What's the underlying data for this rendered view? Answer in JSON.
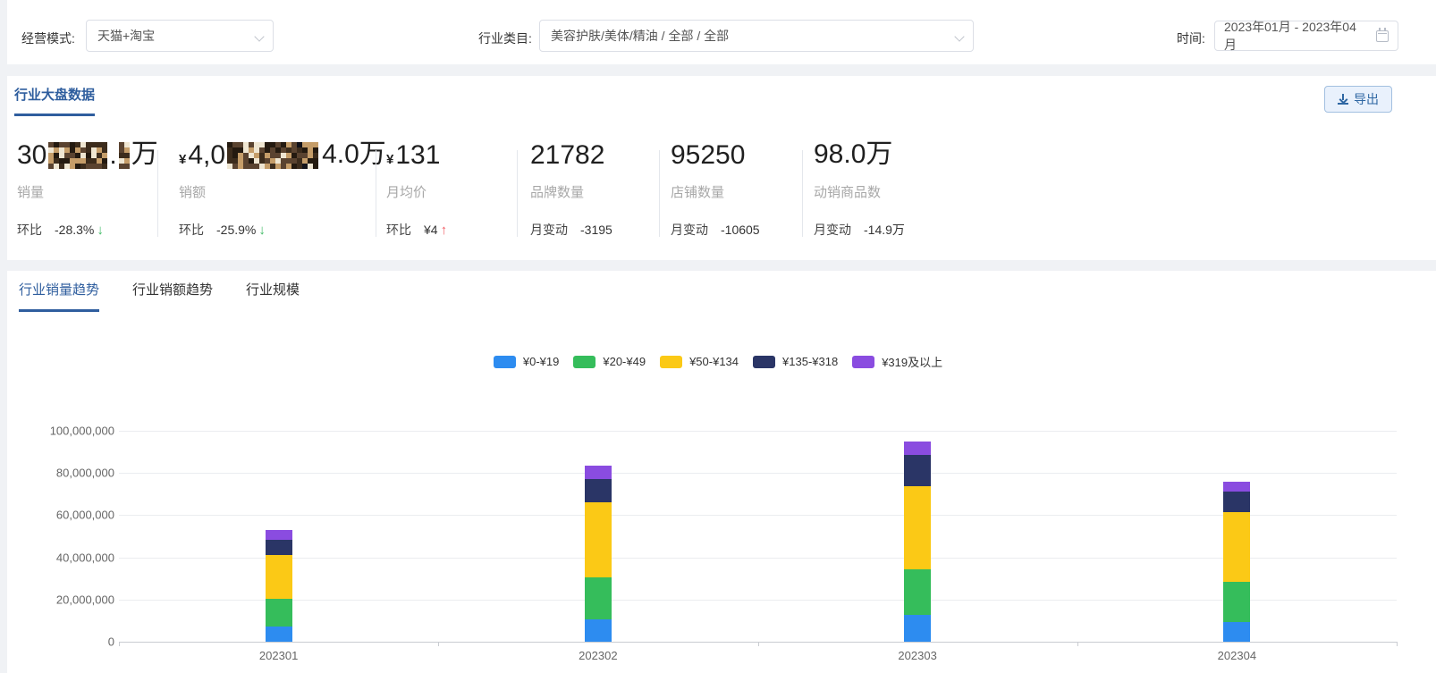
{
  "filters": {
    "mode_label": "经营模式:",
    "mode_value": "天猫+淘宝",
    "category_label": "行业类目:",
    "category_value": "美容护肤/美体/精油 / 全部 / 全部",
    "time_label": "时间:",
    "time_value": "2023年01月 - 2023年04月"
  },
  "overview": {
    "tab_label": "行业大盘数据",
    "export_label": "导出",
    "stats": [
      {
        "label": "销量",
        "censored": true,
        "parts": [
          {
            "t": "text",
            "v": "30"
          },
          {
            "t": "mosaic",
            "w": 66
          },
          {
            "t": "text",
            "v": "."
          },
          {
            "t": "mosaic",
            "w": 12
          },
          {
            "t": "text",
            "v": "万"
          }
        ],
        "change_label": "环比",
        "change_value": "-28.3%",
        "trend": "down"
      },
      {
        "label": "销额",
        "censored": true,
        "parts": [
          {
            "t": "yen",
            "v": "¥"
          },
          {
            "t": "text",
            "v": "4,0"
          },
          {
            "t": "mosaic",
            "w": 104
          },
          {
            "t": "text",
            "v": "4.0万"
          }
        ],
        "change_label": "环比",
        "change_value": "-25.9%",
        "trend": "down"
      },
      {
        "label": "月均价",
        "censored": false,
        "parts": [
          {
            "t": "yen",
            "v": "¥"
          },
          {
            "t": "text",
            "v": "131"
          }
        ],
        "change_label": "环比",
        "change_value": "¥4",
        "trend": "up"
      },
      {
        "label": "品牌数量",
        "censored": false,
        "parts": [
          {
            "t": "text",
            "v": "21782"
          }
        ],
        "change_label": "月变动",
        "change_value": "-3195",
        "trend": "none"
      },
      {
        "label": "店铺数量",
        "censored": false,
        "parts": [
          {
            "t": "text",
            "v": "95250"
          }
        ],
        "change_label": "月变动",
        "change_value": "-10605",
        "trend": "none"
      },
      {
        "label": "动销商品数",
        "censored": false,
        "parts": [
          {
            "t": "text",
            "v": "98.0万"
          }
        ],
        "change_label": "月变动",
        "change_value": "-14.9万",
        "trend": "none"
      }
    ]
  },
  "trend_section": {
    "tabs": [
      {
        "label": "行业销量趋势",
        "active": true
      },
      {
        "label": "行业销额趋势",
        "active": false
      },
      {
        "label": "行业规模",
        "active": false
      }
    ]
  },
  "chart_data": {
    "type": "bar",
    "stacked": true,
    "title": "",
    "xlabel": "",
    "ylabel": "",
    "categories": [
      "202301",
      "202302",
      "202303",
      "202304"
    ],
    "series": [
      {
        "name": "¥0-¥19",
        "color": "#2d8cf0",
        "values": [
          7200000,
          10800000,
          12600000,
          9500000
        ]
      },
      {
        "name": "¥20-¥49",
        "color": "#35bd5b",
        "values": [
          13100000,
          19700000,
          21700000,
          18900000
        ]
      },
      {
        "name": "¥50-¥134",
        "color": "#fbc916",
        "values": [
          21000000,
          35400000,
          39600000,
          33100000
        ]
      },
      {
        "name": "¥135-¥318",
        "color": "#2a3566",
        "values": [
          7100000,
          11100000,
          14600000,
          9800000
        ]
      },
      {
        "name": "¥319及以上",
        "color": "#8a4ce0",
        "values": [
          4700000,
          6400000,
          6600000,
          4400000
        ]
      }
    ],
    "ylim": [
      0,
      100000000
    ],
    "y_ticks": [
      0,
      20000000,
      40000000,
      60000000,
      80000000,
      100000000
    ],
    "grid": true,
    "legend_position": "top"
  },
  "colors": {
    "accent_blue": "#2f5e9e",
    "trend_up_red": "#f25e66",
    "trend_down_green": "#3eb963",
    "export_bg": "#e9f1fc",
    "page_bg": "#f0f2f5"
  }
}
